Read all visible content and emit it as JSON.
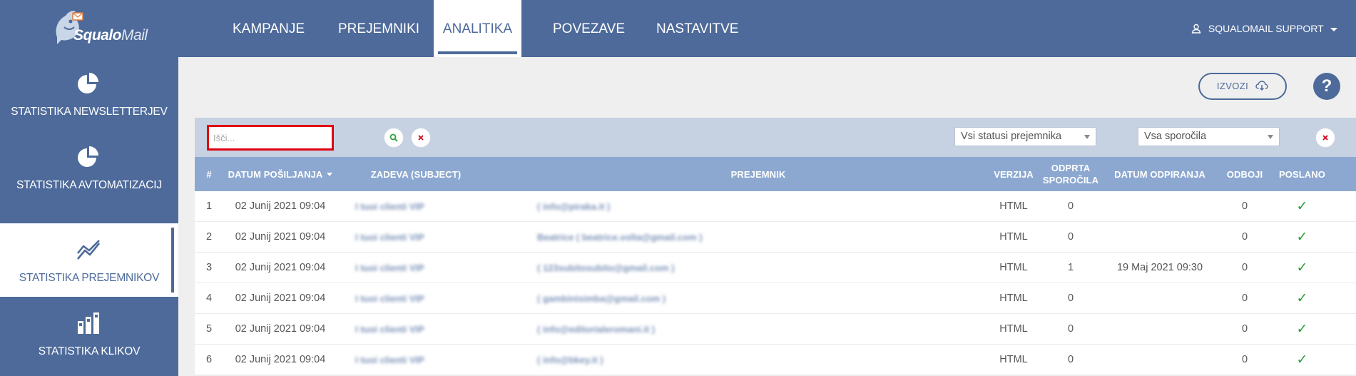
{
  "app": {
    "logo_text_bold": "Squalo",
    "logo_text_light": "Mail"
  },
  "nav": {
    "items": [
      {
        "label": "KAMPANJE"
      },
      {
        "label": "PREJEMNIKI"
      },
      {
        "label": "ANALITIKA",
        "active": true
      },
      {
        "label": "POVEZAVE"
      },
      {
        "label": "NASTAVITVE"
      }
    ],
    "user_label": "SQUALOMAIL SUPPORT",
    "user_icon": "user-icon"
  },
  "sidebar": {
    "items": [
      {
        "label": "STATISTIKA NEWSLETTERJEV",
        "icon": "pie-chart-icon"
      },
      {
        "label": "STATISTIKA AVTOMATIZACIJ",
        "icon": "pie-chart-icon"
      },
      {
        "label": "STATISTIKA PREJEMNIKOV",
        "icon": "trend-line-icon",
        "active": true
      },
      {
        "label": "STATISTIKA KLIKOV",
        "icon": "bar-chart-icon"
      }
    ]
  },
  "toolbar": {
    "export_label": "IZVOZI",
    "export_icon": "cloud-download-icon",
    "help_label": "?"
  },
  "filters": {
    "search_placeholder": "Išči...",
    "search_icon": "search-icon",
    "clear_icon": "close-icon",
    "status_select": "Vsi statusi prejemnika",
    "message_select": "Vsa sporočila"
  },
  "table": {
    "columns": {
      "num": "#",
      "date": "DATUM POŠILJANJA",
      "subject": "ZADEVA (SUBJECT)",
      "recipient": "PREJEMNIK",
      "version": "VERZIJA",
      "opened_line1": "ODPRTA",
      "opened_line2": "SPOROČILA",
      "open_date": "DATUM ODPIRANJA",
      "bounces": "ODBOJI",
      "sent": "POSLANO"
    },
    "rows": [
      {
        "num": "1",
        "date": "02 Junij 2021 09:04",
        "subject": "I tuoi clienti VIP",
        "recipient": "( info@piraka.it )",
        "version": "HTML",
        "opened": "0",
        "open_date": "",
        "bounces": "0",
        "sent": "✓"
      },
      {
        "num": "2",
        "date": "02 Junij 2021 09:04",
        "subject": "I tuoi clienti VIP",
        "recipient": "Beatrice ( beatrice.volta@gmail.com )",
        "version": "HTML",
        "opened": "0",
        "open_date": "",
        "bounces": "0",
        "sent": "✓"
      },
      {
        "num": "3",
        "date": "02 Junij 2021 09:04",
        "subject": "I tuoi clienti VIP",
        "recipient": "( 123subitosubito@gmail.com )",
        "version": "HTML",
        "opened": "1",
        "open_date": "19 Maj 2021 09:30",
        "bounces": "0",
        "sent": "✓"
      },
      {
        "num": "4",
        "date": "02 Junij 2021 09:04",
        "subject": "I tuoi clienti VIP",
        "recipient": "( gambinisimba@gmail.com )",
        "version": "HTML",
        "opened": "0",
        "open_date": "",
        "bounces": "0",
        "sent": "✓"
      },
      {
        "num": "5",
        "date": "02 Junij 2021 09:04",
        "subject": "I tuoi clienti VIP",
        "recipient": "( info@editorialeromani.it )",
        "version": "HTML",
        "opened": "0",
        "open_date": "",
        "bounces": "0",
        "sent": "✓"
      },
      {
        "num": "6",
        "date": "02 Junij 2021 09:04",
        "subject": "I tuoi clienti VIP",
        "recipient": "( info@bkey.it )",
        "version": "HTML",
        "opened": "0",
        "open_date": "",
        "bounces": "0",
        "sent": "✓"
      }
    ]
  },
  "colors": {
    "brand": "#4d6a9a",
    "table_header": "#8ca8d0",
    "filter_bar": "#c6d1e2",
    "search_outline": "#e0000f",
    "check": "#2e9d3b"
  }
}
